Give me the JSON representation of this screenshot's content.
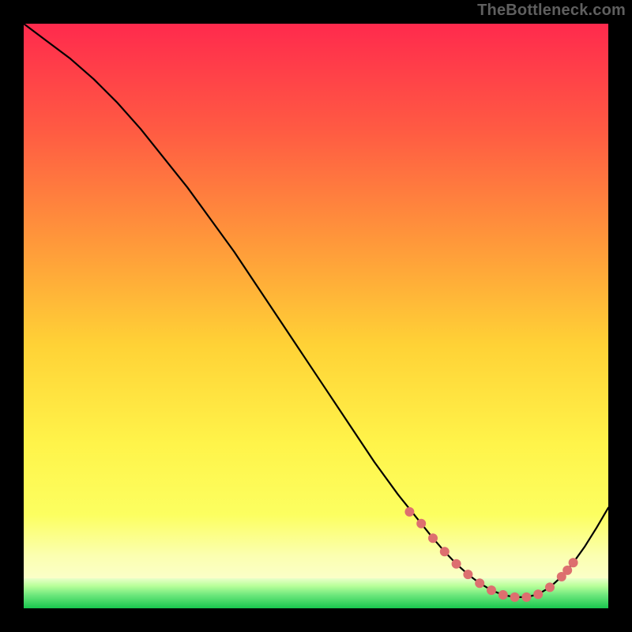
{
  "watermark": "TheBottleneck.com",
  "palette": {
    "background": "#000000",
    "gradient_top": "#ff2a4d",
    "gradient_mid_upper": "#ff7a3d",
    "gradient_mid": "#ffd236",
    "gradient_lower": "#fcff60",
    "gradient_pale": "#fbffc8",
    "gradient_green_top": "#c8ffb0",
    "gradient_green_mid": "#67e87d",
    "gradient_green_bottom": "#19c64e",
    "curve": "#000000",
    "marker": "#dd6f6f"
  },
  "chart_data": {
    "type": "line",
    "title": "",
    "xlabel": "",
    "ylabel": "",
    "xlim": [
      0,
      100
    ],
    "ylim": [
      0,
      100
    ],
    "series": [
      {
        "name": "bottleneck-curve",
        "x": [
          0,
          4,
          8,
          12,
          16,
          20,
          24,
          28,
          32,
          36,
          40,
          44,
          48,
          52,
          56,
          60,
          64,
          68,
          70,
          72,
          74,
          76,
          78,
          80,
          82,
          84,
          86,
          88,
          90,
          92,
          94,
          96,
          98,
          100
        ],
        "y": [
          100,
          97,
          94,
          90.5,
          86.5,
          82,
          77,
          72,
          66.5,
          61,
          55,
          49,
          43,
          37,
          31,
          25,
          19.5,
          14.5,
          12,
          9.7,
          7.6,
          5.8,
          4.3,
          3.1,
          2.3,
          1.9,
          1.9,
          2.4,
          3.6,
          5.4,
          7.8,
          10.6,
          13.8,
          17.2
        ]
      }
    ],
    "markers": {
      "name": "highlight-dots",
      "x": [
        66,
        68,
        70,
        72,
        74,
        76,
        78,
        80,
        82,
        84,
        86,
        88,
        90,
        92,
        93,
        94
      ],
      "y": [
        16.5,
        14.5,
        12,
        9.7,
        7.6,
        5.8,
        4.3,
        3.1,
        2.3,
        1.9,
        1.9,
        2.4,
        3.6,
        5.4,
        6.5,
        7.8
      ]
    },
    "annotations": []
  }
}
